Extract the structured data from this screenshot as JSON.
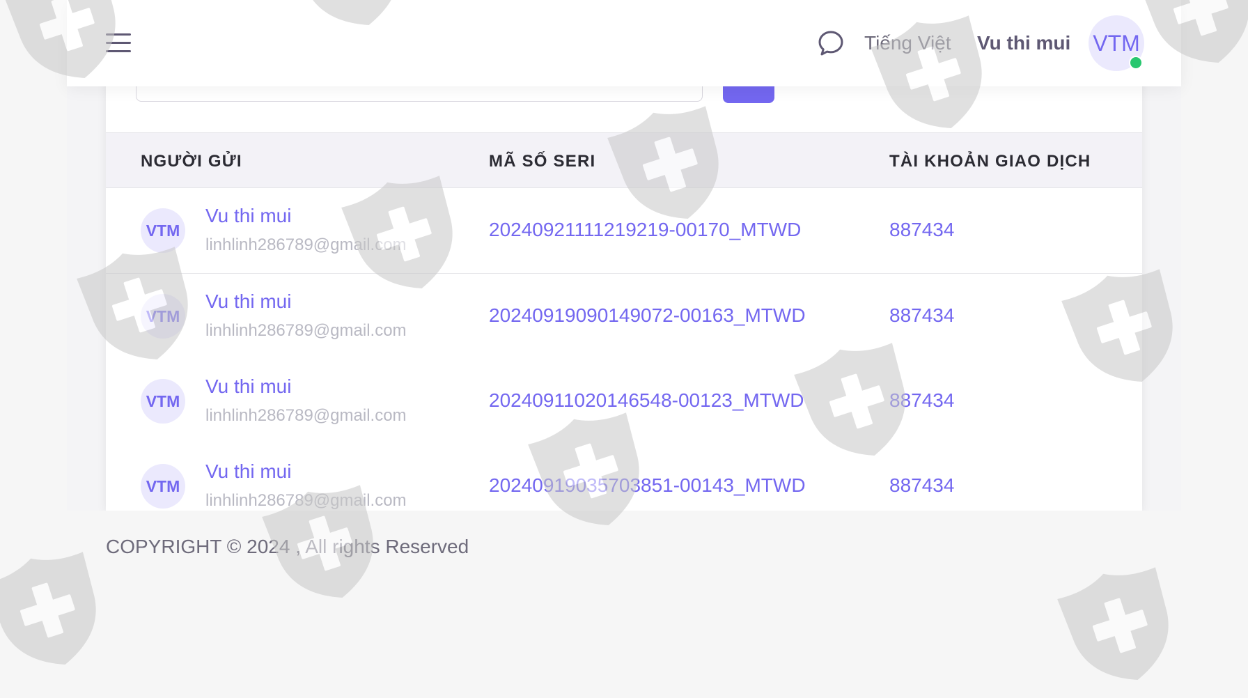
{
  "header": {
    "language": "Tiếng Việt",
    "user_name": "Vu thi mui",
    "avatar_initials": "VTM"
  },
  "table": {
    "columns": [
      "NGƯỜI GỬI",
      "MÃ SỐ SERI",
      "TÀI KHOẢN GIAO DỊCH"
    ],
    "rows": [
      {
        "avatar": "VTM",
        "name": "Vu thi mui",
        "email": "linhlinh286789@gmail.com",
        "serial": "20240921111219219-00170_MTWD",
        "account": "887434"
      },
      {
        "avatar": "VTM",
        "name": "Vu thi mui",
        "email": "linhlinh286789@gmail.com",
        "serial": "20240919090149072-00163_MTWD",
        "account": "887434"
      },
      {
        "avatar": "VTM",
        "name": "Vu thi mui",
        "email": "linhlinh286789@gmail.com",
        "serial": "20240911020146548-00123_MTWD",
        "account": "887434"
      },
      {
        "avatar": "VTM",
        "name": "Vu thi mui",
        "email": "linhlinh286789@gmail.com",
        "serial": "20240919035703851-00143_MTWD",
        "account": "887434"
      }
    ]
  },
  "footer": {
    "copyright": "COPYRIGHT © 2024 , All rights Reserved"
  },
  "colors": {
    "accent": "#7367f0",
    "online": "#28c76f",
    "header_bg": "#f3f2f7",
    "watermark": "#c8c8c8"
  },
  "icons": {
    "menu": "hamburger-icon",
    "chat": "chat-icon",
    "watermark": "shield-cross-watermark"
  }
}
